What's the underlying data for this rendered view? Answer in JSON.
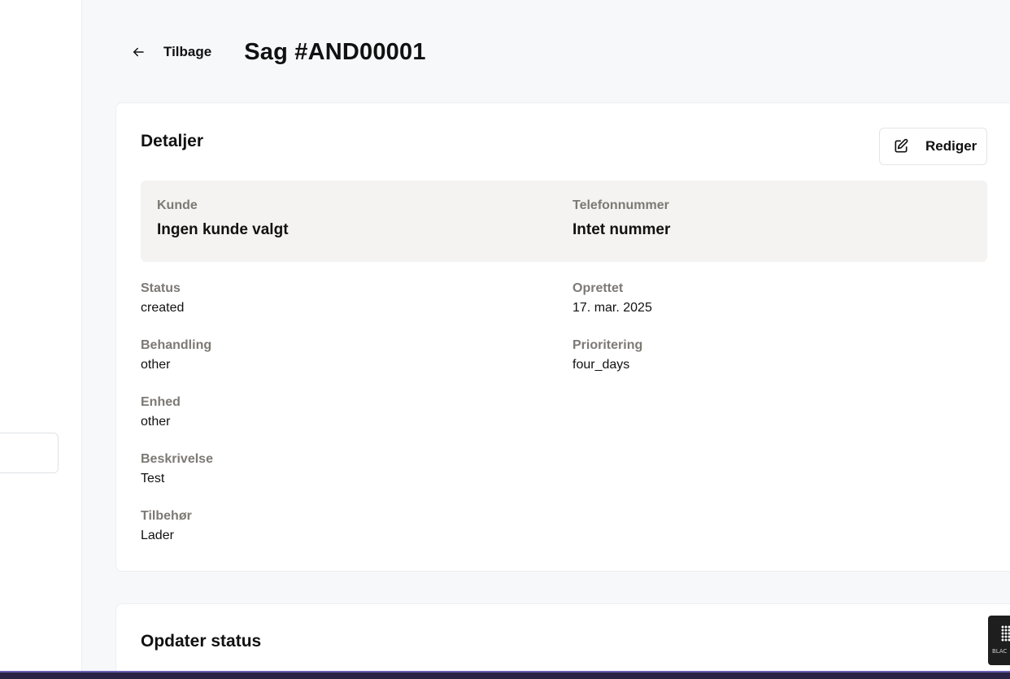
{
  "header": {
    "back_label": "Tilbage",
    "title": "Sag #AND00001"
  },
  "details": {
    "title": "Detaljer",
    "edit_label": "Rediger",
    "customer": {
      "label": "Kunde",
      "value": "Ingen kunde valgt"
    },
    "phone": {
      "label": "Telefonnummer",
      "value": "Intet nummer"
    },
    "fields_left": [
      {
        "label": "Status",
        "value": "created"
      },
      {
        "label": "Behandling",
        "value": "other"
      },
      {
        "label": "Enhed",
        "value": "other"
      },
      {
        "label": "Beskrivelse",
        "value": "Test"
      },
      {
        "label": "Tilbehør",
        "value": "Lader"
      }
    ],
    "fields_right": [
      {
        "label": "Oprettet",
        "value": "17. mar. 2025"
      },
      {
        "label": "Prioritering",
        "value": "four_days"
      }
    ]
  },
  "status_card": {
    "title": "Opdater status"
  },
  "widget": {
    "label": "BLAC"
  },
  "icons": {
    "back": "arrow-left-icon",
    "edit": "pencil-square-icon"
  },
  "colors": {
    "page_bg": "#f7f8fa",
    "card_bg": "#ffffff",
    "info_box_bg": "#f4f3f1",
    "label_color": "#7d7974",
    "bottom_bar": "#2a2244"
  }
}
